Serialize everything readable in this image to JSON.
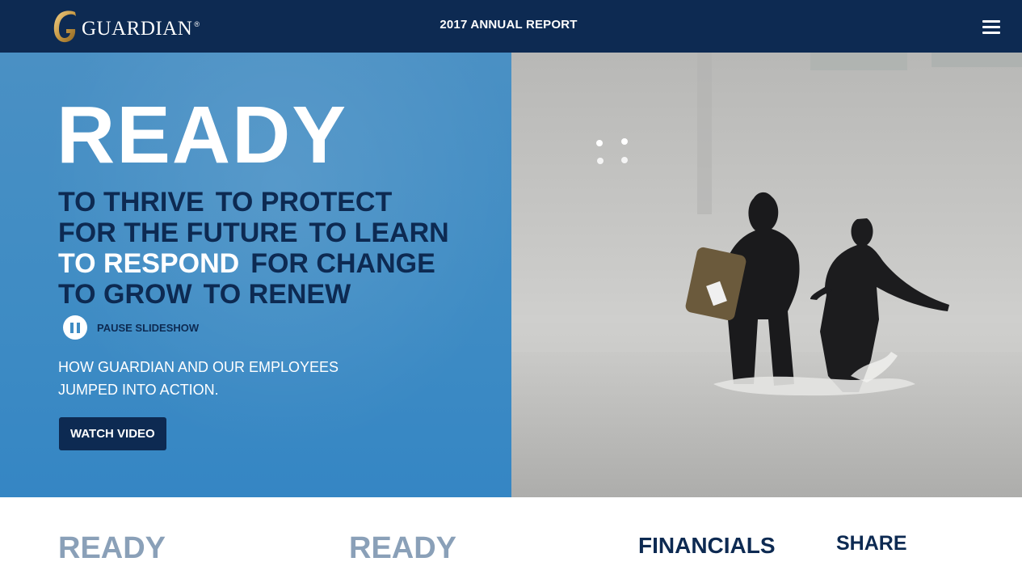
{
  "header": {
    "brand": "GUARDIAN",
    "brand_mark": "®",
    "report_title": "2017 ANNUAL REPORT",
    "menu_icon": "hamburger-menu-icon"
  },
  "hero": {
    "headline": "READY",
    "phrases": [
      [
        "TO THRIVE",
        "TO PROTECT"
      ],
      [
        "FOR THE FUTURE",
        "TO LEARN"
      ],
      [
        "TO RESPOND",
        "FOR CHANGE"
      ],
      [
        "TO GROW",
        "TO RENEW"
      ]
    ],
    "active_phrase": "TO RESPOND",
    "pause_label": "PAUSE SLIDESHOW",
    "subtitle": "HOW GUARDIAN AND OUR EMPLOYEES JUMPED INTO ACTION.",
    "cta_label": "WATCH VIDEO"
  },
  "bottom_nav": {
    "item1": "READY",
    "item2": "READY",
    "item3": "FINANCIALS",
    "item4": "SHARE"
  },
  "colors": {
    "navy": "#0d2a52",
    "hero_blue": "#3f8cc4",
    "nav_grey": "#8aa0b8"
  }
}
